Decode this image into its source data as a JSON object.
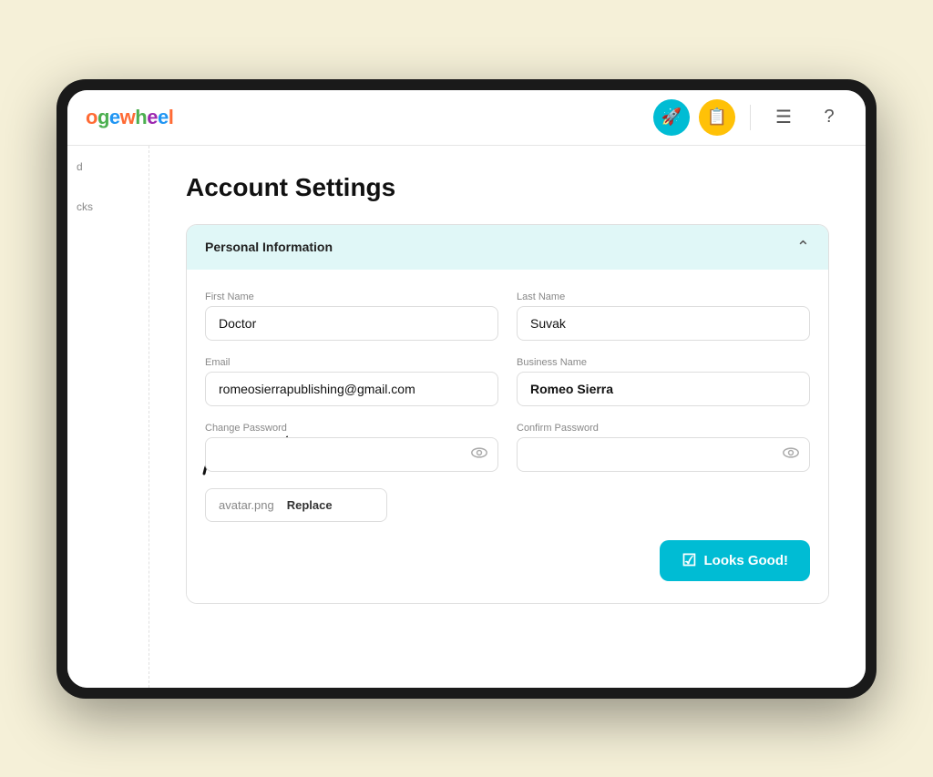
{
  "navbar": {
    "logo_prefix": "ge",
    "logo_full": "gewheel",
    "rocket_icon": "🚀",
    "clipboard_icon": "📋",
    "menu_icon": "☰",
    "help_icon": "?"
  },
  "sidebar": {
    "items": [
      {
        "label": "d"
      },
      {
        "label": "cks"
      }
    ]
  },
  "page": {
    "title": "Account Settings"
  },
  "panel": {
    "header": "Personal Information",
    "fields": {
      "first_name_label": "First Name",
      "first_name_value": "Doctor",
      "last_name_label": "Last Name",
      "last_name_value": "Suvak",
      "email_label": "Email",
      "email_value": "romeosierrapublishing@gmail.com",
      "business_name_label": "Business Name",
      "business_name_value": "Romeo Sierra",
      "change_password_label": "Change Password",
      "confirm_password_label": "Confirm Password"
    },
    "avatar": {
      "filename": "avatar.png",
      "replace_label": "Replace"
    },
    "submit_label": "Looks Good!"
  }
}
